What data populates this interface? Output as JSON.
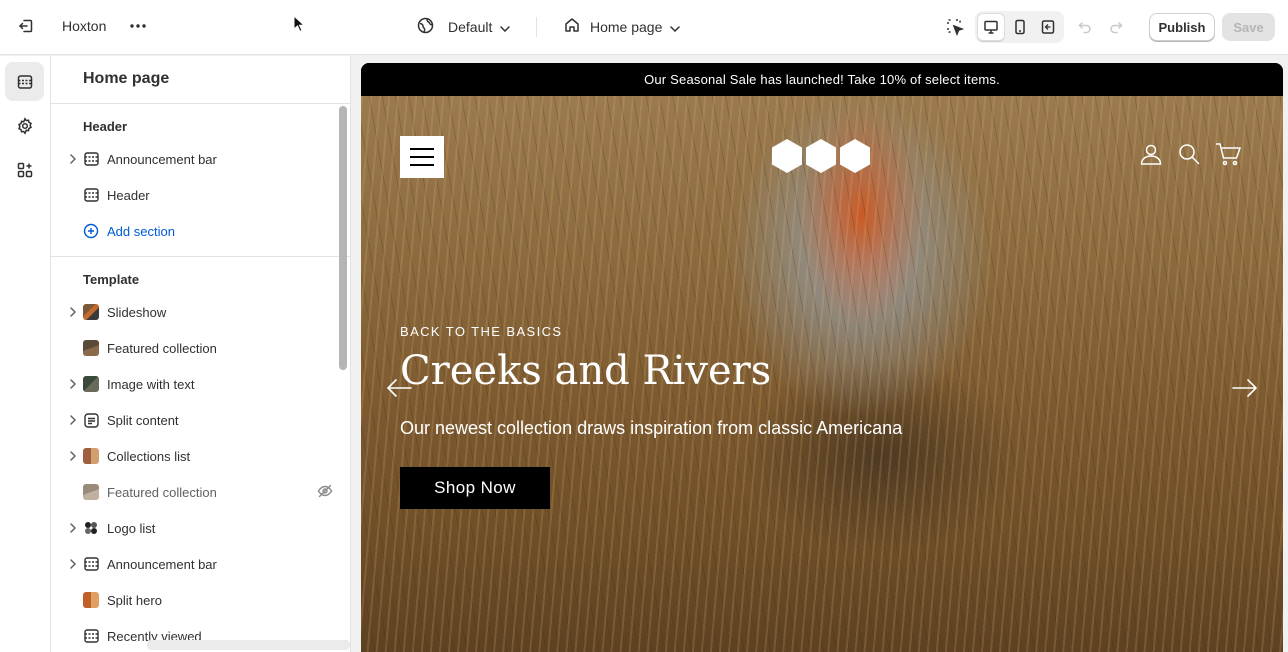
{
  "topbar": {
    "store_name": "Hoxton",
    "theme_select": "Default",
    "page_select": "Home page",
    "publish_label": "Publish",
    "save_label": "Save"
  },
  "sidebar": {
    "title": "Home page",
    "header_group": {
      "title": "Header",
      "items": [
        {
          "label": "Announcement bar",
          "icon": "section-layout-icon",
          "expandable": true
        },
        {
          "label": "Header",
          "icon": "section-layout-icon",
          "expandable": false
        }
      ],
      "add_section": "Add section"
    },
    "template_group": {
      "title": "Template",
      "items": [
        {
          "label": "Slideshow",
          "icon": "slideshow-thumb",
          "expandable": true,
          "hidden": false
        },
        {
          "label": "Featured collection",
          "icon": "collection-thumb",
          "expandable": false,
          "hidden": false
        },
        {
          "label": "Image with text",
          "icon": "image-thumb",
          "expandable": true,
          "hidden": false
        },
        {
          "label": "Split content",
          "icon": "text-block-icon",
          "expandable": true,
          "hidden": false
        },
        {
          "label": "Collections list",
          "icon": "collections-thumb",
          "expandable": true,
          "hidden": false
        },
        {
          "label": "Featured collection",
          "icon": "collection-thumb",
          "expandable": false,
          "hidden": true
        },
        {
          "label": "Logo list",
          "icon": "logo-thumb",
          "expandable": true,
          "hidden": false
        },
        {
          "label": "Announcement bar",
          "icon": "section-layout-icon",
          "expandable": true,
          "hidden": false
        },
        {
          "label": "Split hero",
          "icon": "split-hero-thumb",
          "expandable": false,
          "hidden": false
        },
        {
          "label": "Recently viewed",
          "icon": "section-layout-icon",
          "expandable": false,
          "hidden": false
        }
      ]
    }
  },
  "preview": {
    "announcement": "Our Seasonal Sale has launched! Take 10% of select items.",
    "hero": {
      "eyebrow": "BACK TO THE BASICS",
      "title": "Creeks and Rivers",
      "subtitle": "Our newest collection draws inspiration from classic Americana",
      "button": "Shop Now"
    }
  },
  "colors": {
    "accent": "#005bd3",
    "announcement_bg": "#000000",
    "save_disabled_bg": "#e3e3e3"
  }
}
